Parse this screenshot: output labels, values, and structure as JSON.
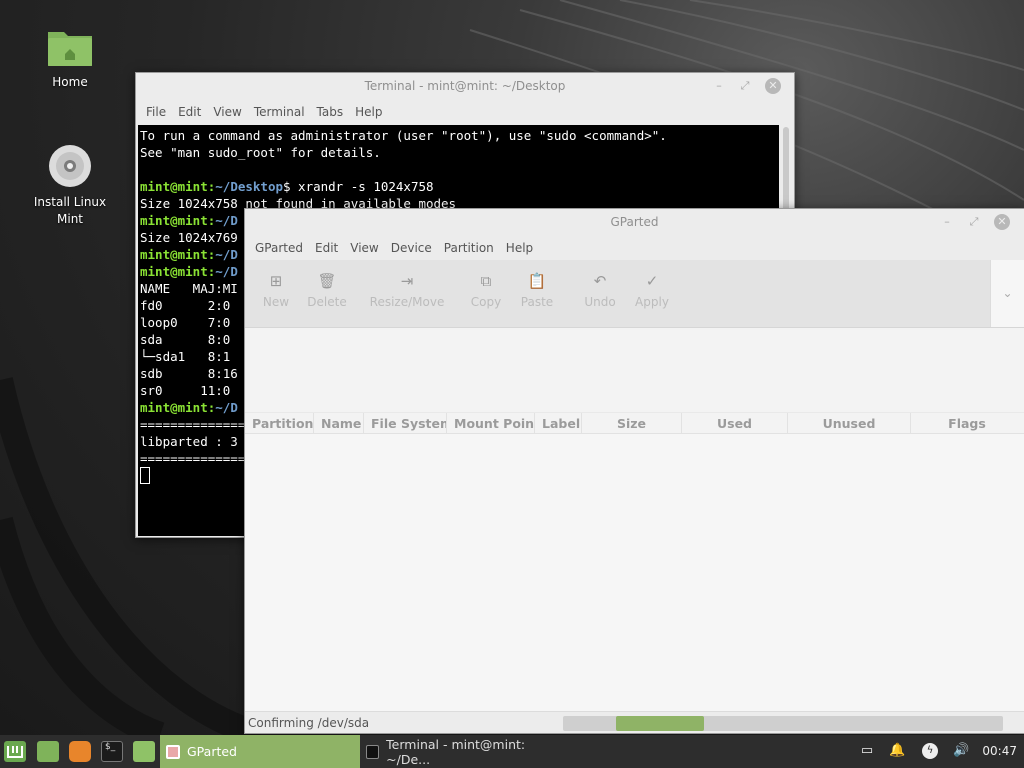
{
  "desktop": {
    "icons": [
      {
        "label": "Home",
        "icon": "folder-home-icon"
      },
      {
        "label_line1": "Install Linux",
        "label_line2": "Mint",
        "icon": "disc-icon"
      }
    ]
  },
  "terminal": {
    "title": "Terminal - mint@mint: ~/Desktop",
    "menu": [
      "File",
      "Edit",
      "View",
      "Terminal",
      "Tabs",
      "Help"
    ],
    "lines": [
      "To run a command as administrator (user \"root\"), use \"sudo <command>\".",
      "See \"man sudo_root\" for details.",
      "",
      "",
      "Size 1024x758 not found in available modes",
      "",
      "Size 1024x769",
      "",
      "",
      "NAME   MAJ:MI",
      "fd0      2:0",
      "loop0    7:0",
      "sda      8:0",
      "└─sda1   8:1",
      "sdb      8:16",
      "sr0     11:0",
      "",
      "==============",
      "libparted : 3",
      "=============="
    ],
    "prompt_user": "mint@mint",
    "prompt_path_full": "~/Desktop",
    "prompt_path_short": "~/D",
    "prompt_path_short2": "~/De",
    "command": " xrandr -s 1024x758"
  },
  "gparted": {
    "title": "GParted",
    "menu": [
      "GParted",
      "Edit",
      "View",
      "Device",
      "Partition",
      "Help"
    ],
    "toolbar": [
      {
        "label": "New",
        "icon": "new-partition-icon"
      },
      {
        "label": "Delete",
        "icon": "trash-icon"
      },
      {
        "label": "Resize/Move",
        "icon": "resize-arrow-icon"
      },
      {
        "label": "Copy",
        "icon": "copy-icon"
      },
      {
        "label": "Paste",
        "icon": "paste-icon"
      },
      {
        "label": "Undo",
        "icon": "undo-icon"
      },
      {
        "label": "Apply",
        "icon": "checkmark-icon"
      }
    ],
    "columns": [
      "Partition",
      "Name",
      "File System",
      "Mount Point",
      "Label",
      "Size",
      "Used",
      "Unused",
      "Flags"
    ],
    "status": "Confirming /dev/sda",
    "progress": {
      "start": 0.12,
      "end": 0.32
    }
  },
  "taskbar": {
    "tasks": [
      {
        "label": "GParted",
        "active": true
      },
      {
        "label": "Terminal - mint@mint: ~/De...",
        "active": false
      }
    ],
    "clock": "00:47",
    "colors": {
      "active_task": "#8fb366",
      "panel": "#2d2d2d"
    }
  }
}
